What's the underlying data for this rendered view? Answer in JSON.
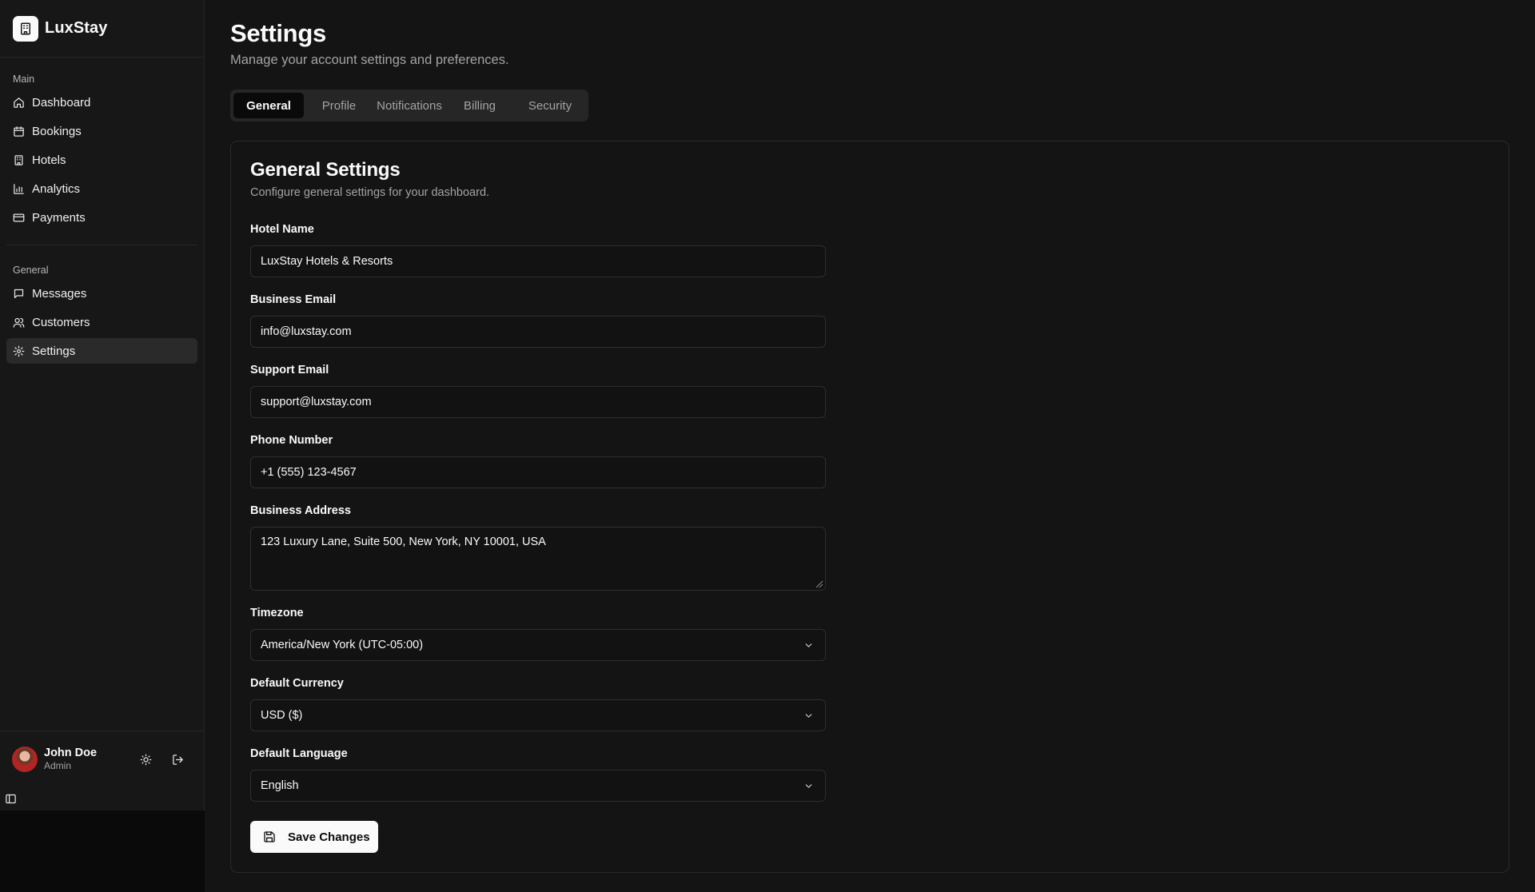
{
  "app": {
    "name": "LuxStay"
  },
  "sidebar": {
    "groups": [
      {
        "label": "Main",
        "items": [
          {
            "label": "Dashboard",
            "icon": "home-icon"
          },
          {
            "label": "Bookings",
            "icon": "calendar-icon"
          },
          {
            "label": "Hotels",
            "icon": "building-icon"
          },
          {
            "label": "Analytics",
            "icon": "bar-chart-icon"
          },
          {
            "label": "Payments",
            "icon": "credit-card-icon"
          }
        ]
      },
      {
        "label": "General",
        "items": [
          {
            "label": "Messages",
            "icon": "message-icon"
          },
          {
            "label": "Customers",
            "icon": "users-icon"
          },
          {
            "label": "Settings",
            "icon": "gear-icon",
            "active": true
          }
        ]
      }
    ],
    "user": {
      "name": "John Doe",
      "role": "Admin"
    }
  },
  "page": {
    "title": "Settings",
    "subtitle": "Manage your account settings and preferences."
  },
  "tabs": [
    {
      "label": "General",
      "active": true
    },
    {
      "label": "Profile"
    },
    {
      "label": "Notifications"
    },
    {
      "label": "Billing"
    },
    {
      "label": "Security"
    }
  ],
  "card": {
    "title": "General Settings",
    "subtitle": "Configure general settings for your dashboard.",
    "fields": {
      "hotel_name": {
        "label": "Hotel Name",
        "value": "LuxStay Hotels & Resorts"
      },
      "business_email": {
        "label": "Business Email",
        "value": "info@luxstay.com"
      },
      "support_email": {
        "label": "Support Email",
        "value": "support@luxstay.com"
      },
      "phone": {
        "label": "Phone Number",
        "value": "+1 (555) 123-4567"
      },
      "address": {
        "label": "Business Address",
        "value": "123 Luxury Lane, Suite 500, New York, NY 10001, USA"
      },
      "timezone": {
        "label": "Timezone",
        "value": "America/New York (UTC-05:00)"
      },
      "currency": {
        "label": "Default Currency",
        "value": "USD ($)"
      },
      "language": {
        "label": "Default Language",
        "value": "English"
      }
    },
    "save_label": "Save Changes"
  },
  "colors": {
    "background": "#141414",
    "sidebar": "#171717",
    "accent": "#fafafa",
    "muted": "#a3a3a3"
  }
}
